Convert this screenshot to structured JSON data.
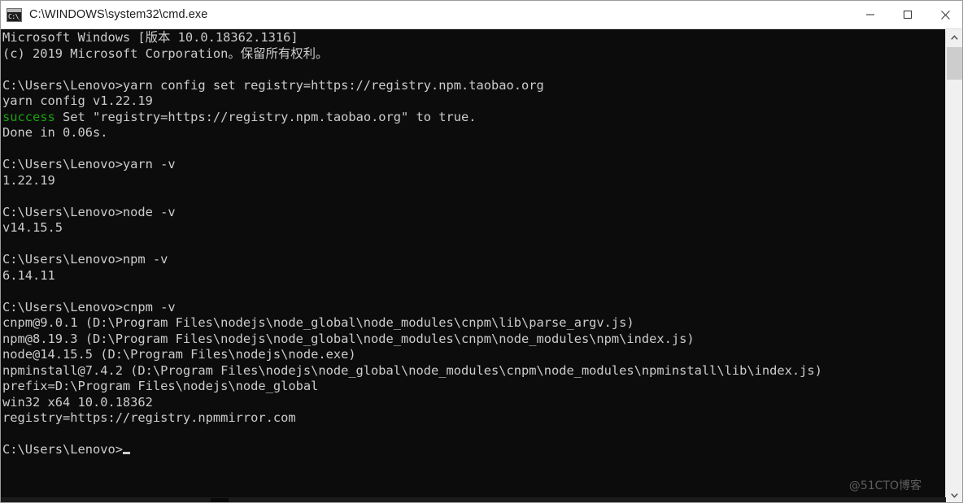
{
  "window": {
    "title": "C:\\WINDOWS\\system32\\cmd.exe",
    "icon_glyph": "C:\\_",
    "controls": {
      "minimize_label": "Minimize",
      "maximize_label": "Maximize",
      "close_label": "Close"
    }
  },
  "terminal": {
    "background_color": "#0c0c0c",
    "text_color": "#cccccc",
    "success_color": "#1ba112",
    "prompt": "C:\\Users\\Lenovo>",
    "lines": [
      {
        "id": "l01",
        "text": "Microsoft Windows [版本 10.0.18362.1316]"
      },
      {
        "id": "l02",
        "text": "(c) 2019 Microsoft Corporation。保留所有权利。"
      },
      {
        "id": "l03",
        "text": ""
      },
      {
        "id": "l04",
        "text": "C:\\Users\\Lenovo>yarn config set registry=https://registry.npm.taobao.org"
      },
      {
        "id": "l05",
        "text": "yarn config v1.22.19"
      },
      {
        "id": "l06",
        "text": "success",
        "rest": " Set \"registry=https://registry.npm.taobao.org\" to true.",
        "style": "success"
      },
      {
        "id": "l07",
        "text": "Done in 0.06s."
      },
      {
        "id": "l08",
        "text": ""
      },
      {
        "id": "l09",
        "text": "C:\\Users\\Lenovo>yarn -v"
      },
      {
        "id": "l10",
        "text": "1.22.19"
      },
      {
        "id": "l11",
        "text": ""
      },
      {
        "id": "l12",
        "text": "C:\\Users\\Lenovo>node -v"
      },
      {
        "id": "l13",
        "text": "v14.15.5"
      },
      {
        "id": "l14",
        "text": ""
      },
      {
        "id": "l15",
        "text": "C:\\Users\\Lenovo>npm -v"
      },
      {
        "id": "l16",
        "text": "6.14.11"
      },
      {
        "id": "l17",
        "text": ""
      },
      {
        "id": "l18",
        "text": "C:\\Users\\Lenovo>cnpm -v"
      },
      {
        "id": "l19",
        "text": "cnpm@9.0.1 (D:\\Program Files\\nodejs\\node_global\\node_modules\\cnpm\\lib\\parse_argv.js)"
      },
      {
        "id": "l20",
        "text": "npm@8.19.3 (D:\\Program Files\\nodejs\\node_global\\node_modules\\cnpm\\node_modules\\npm\\index.js)"
      },
      {
        "id": "l21",
        "text": "node@14.15.5 (D:\\Program Files\\nodejs\\node.exe)"
      },
      {
        "id": "l22",
        "text": "npminstall@7.4.2 (D:\\Program Files\\nodejs\\node_global\\node_modules\\cnpm\\node_modules\\npminstall\\lib\\index.js)"
      },
      {
        "id": "l23",
        "text": "prefix=D:\\Program Files\\nodejs\\node_global"
      },
      {
        "id": "l24",
        "text": "win32 x64 10.0.18362"
      },
      {
        "id": "l25",
        "text": "registry=https://registry.npmmirror.com"
      },
      {
        "id": "l26",
        "text": ""
      },
      {
        "id": "l27",
        "text": "C:\\Users\\Lenovo>",
        "cursor": true
      }
    ]
  },
  "watermark": {
    "text": "@51CTO博客"
  },
  "scrollbar": {
    "up_arrow": "▲",
    "down_arrow": "▼"
  }
}
